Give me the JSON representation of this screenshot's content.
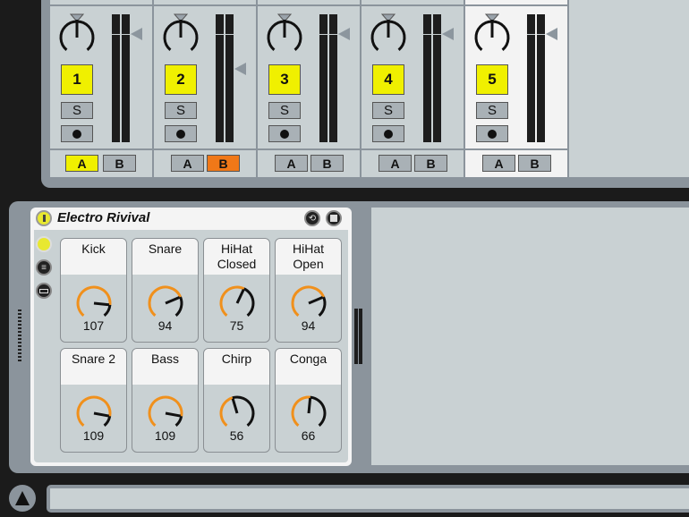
{
  "mixer": {
    "tracks": [
      {
        "number": "1",
        "solo": "S",
        "send_a": "A",
        "send_b": "B",
        "a_on": true,
        "b_on": false,
        "vol_marker": "high",
        "record": "dot"
      },
      {
        "number": "2",
        "solo": "S",
        "send_a": "A",
        "send_b": "B",
        "a_on": false,
        "b_on": true,
        "vol_marker": "low",
        "record": "dot"
      },
      {
        "number": "3",
        "solo": "S",
        "send_a": "A",
        "send_b": "B",
        "a_on": false,
        "b_on": false,
        "vol_marker": "high",
        "record": "dot"
      },
      {
        "number": "4",
        "solo": "S",
        "send_a": "A",
        "send_b": "B",
        "a_on": false,
        "b_on": false,
        "vol_marker": "high",
        "record": "dot"
      },
      {
        "number": "5",
        "solo": "S",
        "send_a": "A",
        "send_b": "B",
        "a_on": false,
        "b_on": false,
        "vol_marker": "high",
        "record": "clock",
        "selected": true
      }
    ]
  },
  "device": {
    "title": "Electro Rivival",
    "value_max": 127,
    "pads": [
      {
        "label": "Kick",
        "value": 107
      },
      {
        "label": "Snare",
        "value": 94
      },
      {
        "label": "HiHat Closed",
        "value": 75
      },
      {
        "label": "HiHat Open",
        "value": 94
      },
      {
        "label": "Snare 2",
        "value": 109
      },
      {
        "label": "Bass",
        "value": 109
      },
      {
        "label": "Chirp",
        "value": 56
      },
      {
        "label": "Conga",
        "value": 66
      }
    ]
  },
  "colors": {
    "accent_yellow": "#f0f000",
    "accent_orange": "#f07818",
    "knob_orange": "#f0901c"
  }
}
